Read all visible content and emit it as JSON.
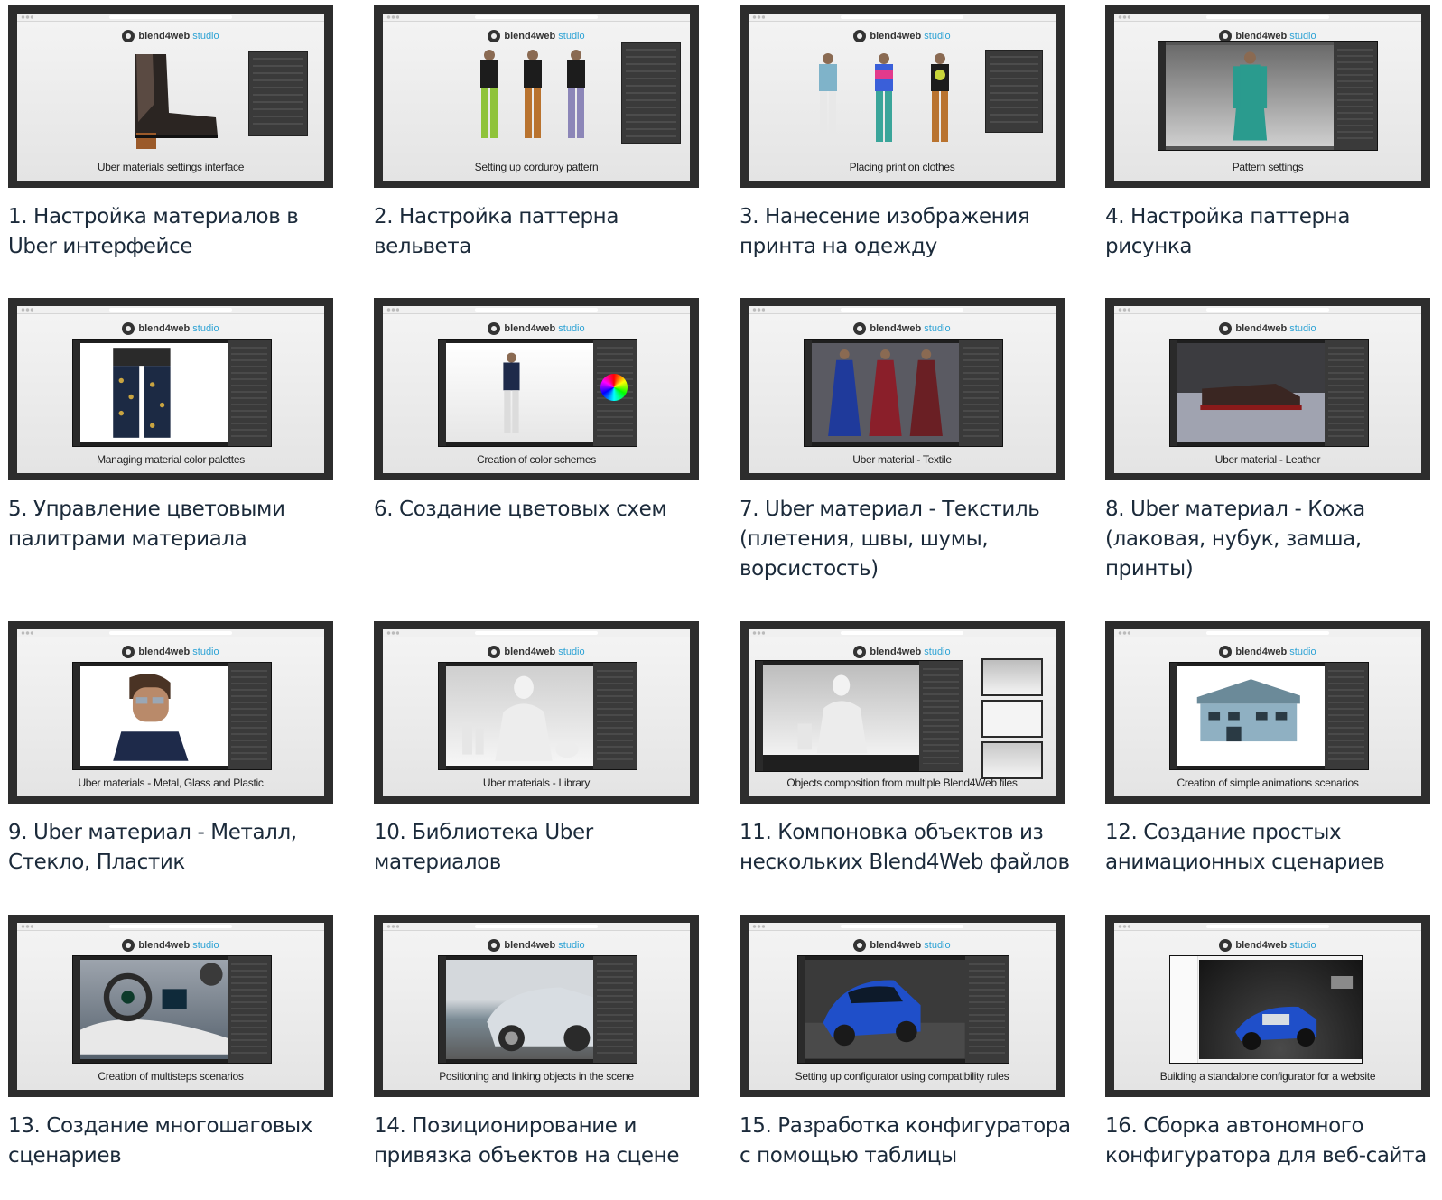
{
  "brand": {
    "name": "blend4web",
    "suffix": "studio"
  },
  "colors": {
    "title_text": "#1b2a3a",
    "studio_accent": "#2ea3d5",
    "frame": "#2d2d2d"
  },
  "items": [
    {
      "caption": "Uber materials settings interface",
      "title": "1. Настройка материалов в Uber интерфейсе",
      "scene": "boot"
    },
    {
      "caption": "Setting up corduroy pattern",
      "title": "2. Настройка паттерна вельвета",
      "scene": "men-corduroy"
    },
    {
      "caption": "Placing print on clothes",
      "title": "3. Нанесение изображения принта на одежду",
      "scene": "men-print"
    },
    {
      "caption": "Pattern settings",
      "title": "4. Настройка паттерна рисунка",
      "scene": "dress"
    },
    {
      "caption": "Managing material color palettes",
      "title": "5. Управление цветовыми палитрами материала",
      "scene": "trousers"
    },
    {
      "caption": "Creation of color schemes",
      "title": "6. Создание цветовых схем",
      "scene": "man-white"
    },
    {
      "caption": "Uber material - Textile",
      "title": "7. Uber материал - Текстиль (плетения, швы, шумы, ворсистость)",
      "scene": "dresses"
    },
    {
      "caption": "Uber material - Leather",
      "title": "8. Uber материал - Кожа (лаковая, нубук, замша, принты)",
      "scene": "shoe"
    },
    {
      "caption": "Uber materials - Metal, Glass and Plastic",
      "title": "9. Uber материал - Металл, Стекло, Пластик",
      "scene": "glasses"
    },
    {
      "caption": "Uber materials - Library",
      "title": "10. Библиотека Uber материалов",
      "scene": "bust"
    },
    {
      "caption": "Objects composition from multiple Blend4Web files",
      "title": "11. Компоновка объектов из нескольких Blend4Web файлов",
      "scene": "compose"
    },
    {
      "caption": "Creation of simple animations scenarios",
      "title": "12. Создание простых анимационных сценариев",
      "scene": "house"
    },
    {
      "caption": "Creation of multisteps scenarios",
      "title": "13. Создание многошаговых сценариев",
      "scene": "car-interior"
    },
    {
      "caption": "Positioning and linking objects in the scene",
      "title": "14. Позиционирование и привязка объектов на сцене",
      "scene": "car-road"
    },
    {
      "caption": "Setting up configurator using compatibility rules",
      "title": "15. Разработка конфигуратора с помощью таблицы",
      "scene": "car-blue"
    },
    {
      "caption": "Building a standalone configurator for a website",
      "title": "16. Сборка автономного конфигуратора для веб-сайта",
      "scene": "car-showroom"
    }
  ]
}
